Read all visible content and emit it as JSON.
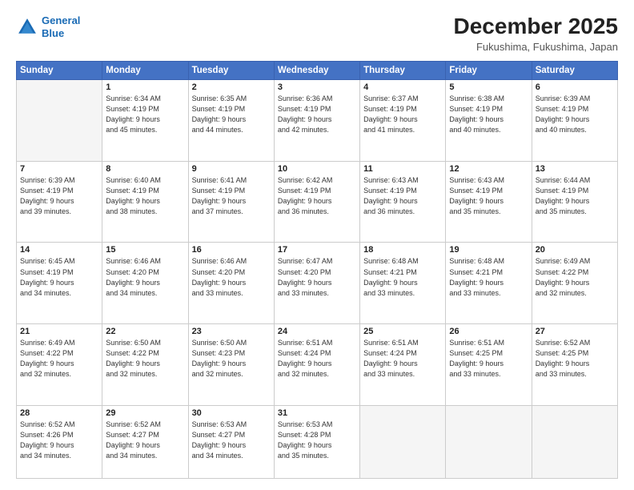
{
  "logo": {
    "line1": "General",
    "line2": "Blue"
  },
  "title": "December 2025",
  "subtitle": "Fukushima, Fukushima, Japan",
  "days_header": [
    "Sunday",
    "Monday",
    "Tuesday",
    "Wednesday",
    "Thursday",
    "Friday",
    "Saturday"
  ],
  "weeks": [
    [
      {
        "day": "",
        "info": ""
      },
      {
        "day": "1",
        "info": "Sunrise: 6:34 AM\nSunset: 4:19 PM\nDaylight: 9 hours\nand 45 minutes."
      },
      {
        "day": "2",
        "info": "Sunrise: 6:35 AM\nSunset: 4:19 PM\nDaylight: 9 hours\nand 44 minutes."
      },
      {
        "day": "3",
        "info": "Sunrise: 6:36 AM\nSunset: 4:19 PM\nDaylight: 9 hours\nand 42 minutes."
      },
      {
        "day": "4",
        "info": "Sunrise: 6:37 AM\nSunset: 4:19 PM\nDaylight: 9 hours\nand 41 minutes."
      },
      {
        "day": "5",
        "info": "Sunrise: 6:38 AM\nSunset: 4:19 PM\nDaylight: 9 hours\nand 40 minutes."
      },
      {
        "day": "6",
        "info": "Sunrise: 6:39 AM\nSunset: 4:19 PM\nDaylight: 9 hours\nand 40 minutes."
      }
    ],
    [
      {
        "day": "7",
        "info": "Sunrise: 6:39 AM\nSunset: 4:19 PM\nDaylight: 9 hours\nand 39 minutes."
      },
      {
        "day": "8",
        "info": "Sunrise: 6:40 AM\nSunset: 4:19 PM\nDaylight: 9 hours\nand 38 minutes."
      },
      {
        "day": "9",
        "info": "Sunrise: 6:41 AM\nSunset: 4:19 PM\nDaylight: 9 hours\nand 37 minutes."
      },
      {
        "day": "10",
        "info": "Sunrise: 6:42 AM\nSunset: 4:19 PM\nDaylight: 9 hours\nand 36 minutes."
      },
      {
        "day": "11",
        "info": "Sunrise: 6:43 AM\nSunset: 4:19 PM\nDaylight: 9 hours\nand 36 minutes."
      },
      {
        "day": "12",
        "info": "Sunrise: 6:43 AM\nSunset: 4:19 PM\nDaylight: 9 hours\nand 35 minutes."
      },
      {
        "day": "13",
        "info": "Sunrise: 6:44 AM\nSunset: 4:19 PM\nDaylight: 9 hours\nand 35 minutes."
      }
    ],
    [
      {
        "day": "14",
        "info": "Sunrise: 6:45 AM\nSunset: 4:19 PM\nDaylight: 9 hours\nand 34 minutes."
      },
      {
        "day": "15",
        "info": "Sunrise: 6:46 AM\nSunset: 4:20 PM\nDaylight: 9 hours\nand 34 minutes."
      },
      {
        "day": "16",
        "info": "Sunrise: 6:46 AM\nSunset: 4:20 PM\nDaylight: 9 hours\nand 33 minutes."
      },
      {
        "day": "17",
        "info": "Sunrise: 6:47 AM\nSunset: 4:20 PM\nDaylight: 9 hours\nand 33 minutes."
      },
      {
        "day": "18",
        "info": "Sunrise: 6:48 AM\nSunset: 4:21 PM\nDaylight: 9 hours\nand 33 minutes."
      },
      {
        "day": "19",
        "info": "Sunrise: 6:48 AM\nSunset: 4:21 PM\nDaylight: 9 hours\nand 33 minutes."
      },
      {
        "day": "20",
        "info": "Sunrise: 6:49 AM\nSunset: 4:22 PM\nDaylight: 9 hours\nand 32 minutes."
      }
    ],
    [
      {
        "day": "21",
        "info": "Sunrise: 6:49 AM\nSunset: 4:22 PM\nDaylight: 9 hours\nand 32 minutes."
      },
      {
        "day": "22",
        "info": "Sunrise: 6:50 AM\nSunset: 4:22 PM\nDaylight: 9 hours\nand 32 minutes."
      },
      {
        "day": "23",
        "info": "Sunrise: 6:50 AM\nSunset: 4:23 PM\nDaylight: 9 hours\nand 32 minutes."
      },
      {
        "day": "24",
        "info": "Sunrise: 6:51 AM\nSunset: 4:24 PM\nDaylight: 9 hours\nand 32 minutes."
      },
      {
        "day": "25",
        "info": "Sunrise: 6:51 AM\nSunset: 4:24 PM\nDaylight: 9 hours\nand 33 minutes."
      },
      {
        "day": "26",
        "info": "Sunrise: 6:51 AM\nSunset: 4:25 PM\nDaylight: 9 hours\nand 33 minutes."
      },
      {
        "day": "27",
        "info": "Sunrise: 6:52 AM\nSunset: 4:25 PM\nDaylight: 9 hours\nand 33 minutes."
      }
    ],
    [
      {
        "day": "28",
        "info": "Sunrise: 6:52 AM\nSunset: 4:26 PM\nDaylight: 9 hours\nand 34 minutes."
      },
      {
        "day": "29",
        "info": "Sunrise: 6:52 AM\nSunset: 4:27 PM\nDaylight: 9 hours\nand 34 minutes."
      },
      {
        "day": "30",
        "info": "Sunrise: 6:53 AM\nSunset: 4:27 PM\nDaylight: 9 hours\nand 34 minutes."
      },
      {
        "day": "31",
        "info": "Sunrise: 6:53 AM\nSunset: 4:28 PM\nDaylight: 9 hours\nand 35 minutes."
      },
      {
        "day": "",
        "info": ""
      },
      {
        "day": "",
        "info": ""
      },
      {
        "day": "",
        "info": ""
      }
    ]
  ]
}
